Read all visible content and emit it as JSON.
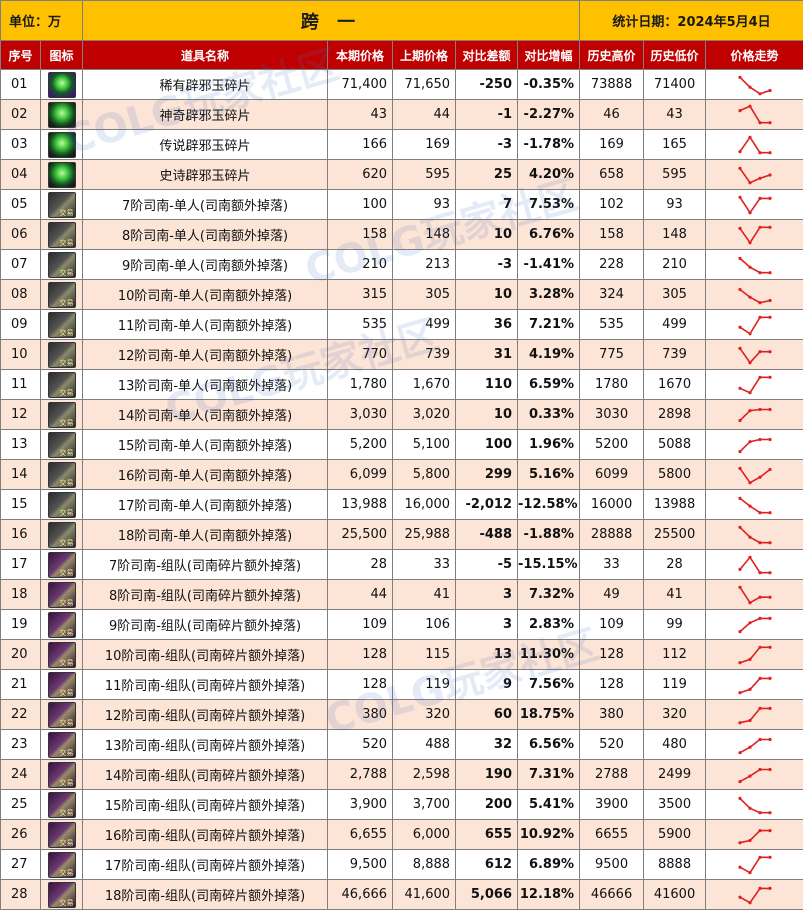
{
  "header": {
    "unit_label": "单位：万",
    "title": "跨 一",
    "date_label": "统计日期：2024年5月4日"
  },
  "columns": [
    "序号",
    "图标",
    "道具名称",
    "本期价格",
    "上期价格",
    "对比差额",
    "对比增幅",
    "历史高价",
    "历史低价",
    "价格走势"
  ],
  "rows": [
    {
      "no": "01",
      "icon": "jade-fragment-icon",
      "name": "稀有辟邪玉碎片",
      "current": "71,400",
      "previous": "71,650",
      "diff": "-250",
      "pct": "-0.35%",
      "high": "73888",
      "low": "71400"
    },
    {
      "no": "02",
      "icon": "jade-fragment-icon",
      "name": "神奇辟邪玉碎片",
      "current": "43",
      "previous": "44",
      "diff": "-1",
      "pct": "-2.27%",
      "high": "46",
      "low": "43"
    },
    {
      "no": "03",
      "icon": "jade-fragment-icon",
      "name": "传说辟邪玉碎片",
      "current": "166",
      "previous": "169",
      "diff": "-3",
      "pct": "-1.78%",
      "high": "169",
      "low": "165"
    },
    {
      "no": "04",
      "icon": "jade-fragment-icon",
      "name": "史诗辟邪玉碎片",
      "current": "620",
      "previous": "595",
      "diff": "25",
      "pct": "4.20%",
      "high": "658",
      "low": "595"
    },
    {
      "no": "05",
      "icon": "lance-solo-icon",
      "name": "7阶司南-单人(司南额外掉落)",
      "current": "100",
      "previous": "93",
      "diff": "7",
      "pct": "7.53%",
      "high": "102",
      "low": "93"
    },
    {
      "no": "06",
      "icon": "lance-solo-icon",
      "name": "8阶司南-单人(司南额外掉落)",
      "current": "158",
      "previous": "148",
      "diff": "10",
      "pct": "6.76%",
      "high": "158",
      "low": "148"
    },
    {
      "no": "07",
      "icon": "lance-solo-icon",
      "name": "9阶司南-单人(司南额外掉落)",
      "current": "210",
      "previous": "213",
      "diff": "-3",
      "pct": "-1.41%",
      "high": "228",
      "low": "210"
    },
    {
      "no": "08",
      "icon": "lance-solo-icon",
      "name": "10阶司南-单人(司南额外掉落)",
      "current": "315",
      "previous": "305",
      "diff": "10",
      "pct": "3.28%",
      "high": "324",
      "low": "305"
    },
    {
      "no": "09",
      "icon": "lance-solo-icon",
      "name": "11阶司南-单人(司南额外掉落)",
      "current": "535",
      "previous": "499",
      "diff": "36",
      "pct": "7.21%",
      "high": "535",
      "low": "499"
    },
    {
      "no": "10",
      "icon": "lance-solo-icon",
      "name": "12阶司南-单人(司南额外掉落)",
      "current": "770",
      "previous": "739",
      "diff": "31",
      "pct": "4.19%",
      "high": "775",
      "low": "739"
    },
    {
      "no": "11",
      "icon": "lance-solo-icon",
      "name": "13阶司南-单人(司南额外掉落)",
      "current": "1,780",
      "previous": "1,670",
      "diff": "110",
      "pct": "6.59%",
      "high": "1780",
      "low": "1670"
    },
    {
      "no": "12",
      "icon": "lance-solo-icon",
      "name": "14阶司南-单人(司南额外掉落)",
      "current": "3,030",
      "previous": "3,020",
      "diff": "10",
      "pct": "0.33%",
      "high": "3030",
      "low": "2898"
    },
    {
      "no": "13",
      "icon": "lance-solo-icon",
      "name": "15阶司南-单人(司南额外掉落)",
      "current": "5,200",
      "previous": "5,100",
      "diff": "100",
      "pct": "1.96%",
      "high": "5200",
      "low": "5088"
    },
    {
      "no": "14",
      "icon": "lance-solo-icon",
      "name": "16阶司南-单人(司南额外掉落)",
      "current": "6,099",
      "previous": "5,800",
      "diff": "299",
      "pct": "5.16%",
      "high": "6099",
      "low": "5800"
    },
    {
      "no": "15",
      "icon": "lance-solo-icon",
      "name": "17阶司南-单人(司南额外掉落)",
      "current": "13,988",
      "previous": "16,000",
      "diff": "-2,012",
      "pct": "-12.58%",
      "high": "16000",
      "low": "13988"
    },
    {
      "no": "16",
      "icon": "lance-solo-icon",
      "name": "18阶司南-单人(司南额外掉落)",
      "current": "25,500",
      "previous": "25,988",
      "diff": "-488",
      "pct": "-1.88%",
      "high": "28888",
      "low": "25500"
    },
    {
      "no": "17",
      "icon": "lance-team-icon",
      "name": "7阶司南-组队(司南碎片额外掉落)",
      "current": "28",
      "previous": "33",
      "diff": "-5",
      "pct": "-15.15%",
      "high": "33",
      "low": "28"
    },
    {
      "no": "18",
      "icon": "lance-team-icon",
      "name": "8阶司南-组队(司南碎片额外掉落)",
      "current": "44",
      "previous": "41",
      "diff": "3",
      "pct": "7.32%",
      "high": "49",
      "low": "41"
    },
    {
      "no": "19",
      "icon": "lance-team-icon",
      "name": "9阶司南-组队(司南碎片额外掉落)",
      "current": "109",
      "previous": "106",
      "diff": "3",
      "pct": "2.83%",
      "high": "109",
      "low": "99"
    },
    {
      "no": "20",
      "icon": "lance-team-icon",
      "name": "10阶司南-组队(司南碎片额外掉落)",
      "current": "128",
      "previous": "115",
      "diff": "13",
      "pct": "11.30%",
      "high": "128",
      "low": "112"
    },
    {
      "no": "21",
      "icon": "lance-team-icon",
      "name": "11阶司南-组队(司南碎片额外掉落)",
      "current": "128",
      "previous": "119",
      "diff": "9",
      "pct": "7.56%",
      "high": "128",
      "low": "119"
    },
    {
      "no": "22",
      "icon": "lance-team-icon",
      "name": "12阶司南-组队(司南碎片额外掉落)",
      "current": "380",
      "previous": "320",
      "diff": "60",
      "pct": "18.75%",
      "high": "380",
      "low": "320"
    },
    {
      "no": "23",
      "icon": "lance-team-icon",
      "name": "13阶司南-组队(司南碎片额外掉落)",
      "current": "520",
      "previous": "488",
      "diff": "32",
      "pct": "6.56%",
      "high": "520",
      "low": "480"
    },
    {
      "no": "24",
      "icon": "lance-team-icon",
      "name": "14阶司南-组队(司南碎片额外掉落)",
      "current": "2,788",
      "previous": "2,598",
      "diff": "190",
      "pct": "7.31%",
      "high": "2788",
      "low": "2499"
    },
    {
      "no": "25",
      "icon": "lance-team-icon",
      "name": "15阶司南-组队(司南碎片额外掉落)",
      "current": "3,900",
      "previous": "3,700",
      "diff": "200",
      "pct": "5.41%",
      "high": "3900",
      "low": "3500"
    },
    {
      "no": "26",
      "icon": "lance-team-icon",
      "name": "16阶司南-组队(司南碎片额外掉落)",
      "current": "6,655",
      "previous": "6,000",
      "diff": "655",
      "pct": "10.92%",
      "high": "6655",
      "low": "5900"
    },
    {
      "no": "27",
      "icon": "lance-team-icon",
      "name": "17阶司南-组队(司南碎片额外掉落)",
      "current": "9,500",
      "previous": "8,888",
      "diff": "612",
      "pct": "6.89%",
      "high": "9500",
      "low": "8888"
    },
    {
      "no": "28",
      "icon": "lance-team-icon",
      "name": "18阶司南-组队(司南碎片额外掉落)",
      "current": "46,666",
      "previous": "41,600",
      "diff": "5,066",
      "pct": "12.18%",
      "high": "46666",
      "low": "41600"
    }
  ],
  "trends": [
    [
      0.15,
      0.6,
      0.9,
      0.75
    ],
    [
      0.3,
      0.1,
      0.85,
      0.85
    ],
    [
      0.8,
      0.15,
      0.85,
      0.85
    ],
    [
      0.2,
      0.85,
      0.65,
      0.5
    ],
    [
      0.15,
      0.85,
      0.2,
      0.2
    ],
    [
      0.2,
      0.85,
      0.15,
      0.15
    ],
    [
      0.2,
      0.6,
      0.85,
      0.85
    ],
    [
      0.25,
      0.6,
      0.85,
      0.75
    ],
    [
      0.6,
      0.9,
      0.15,
      0.15
    ],
    [
      0.2,
      0.85,
      0.35,
      0.35
    ],
    [
      0.65,
      0.85,
      0.15,
      0.15
    ],
    [
      0.75,
      0.3,
      0.25,
      0.25
    ],
    [
      0.8,
      0.35,
      0.25,
      0.25
    ],
    [
      0.2,
      0.85,
      0.6,
      0.25
    ],
    [
      0.2,
      0.55,
      0.85,
      0.85
    ],
    [
      0.15,
      0.6,
      0.85,
      0.85
    ],
    [
      0.7,
      0.15,
      0.85,
      0.85
    ],
    [
      0.15,
      0.85,
      0.6,
      0.6
    ],
    [
      0.8,
      0.4,
      0.2,
      0.2
    ],
    [
      0.85,
      0.7,
      0.15,
      0.15
    ],
    [
      0.85,
      0.7,
      0.2,
      0.2
    ],
    [
      0.85,
      0.75,
      0.2,
      0.2
    ],
    [
      0.85,
      0.6,
      0.25,
      0.25
    ],
    [
      0.8,
      0.55,
      0.25,
      0.25
    ],
    [
      0.2,
      0.65,
      0.85,
      0.85
    ],
    [
      0.85,
      0.75,
      0.3,
      0.3
    ],
    [
      0.6,
      0.85,
      0.15,
      0.15
    ],
    [
      0.6,
      0.85,
      0.2,
      0.2
    ]
  ],
  "icon_tags": {
    "solo": "交易",
    "team": "交易"
  },
  "watermark": "COLG玩家社区",
  "colors": {
    "header_gold": "#ffc000",
    "column_header_red": "#c00000",
    "row_stripe": "#fce4d6",
    "increase_red": "#e00000",
    "decrease_green": "#10a040",
    "trend_line": "#e02020"
  }
}
